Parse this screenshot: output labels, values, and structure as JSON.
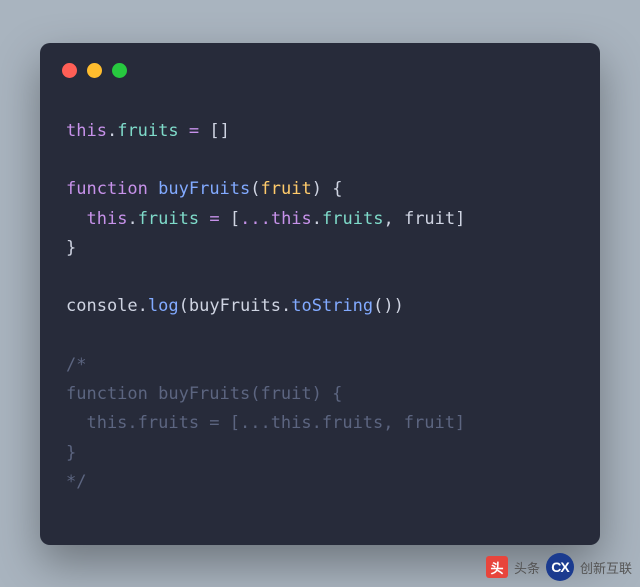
{
  "code": {
    "l1": {
      "this": "this",
      "dot": ".",
      "prop": "fruits",
      "sp": " ",
      "eq": "=",
      "sp2": " ",
      "br": "[]"
    },
    "l2": "",
    "l3": {
      "fn": "function",
      "sp": " ",
      "name": "buyFruits",
      "op": "(",
      "param": "fruit",
      "cp": ")",
      "sp2": " ",
      "ob": "{"
    },
    "l4": {
      "ind": "  ",
      "this": "this",
      "dot": ".",
      "prop": "fruits",
      "sp": " ",
      "eq": "=",
      "sp2": " ",
      "ob": "[",
      "spr": "...",
      "this2": "this",
      "dot2": ".",
      "prop2": "fruits",
      "cm": ",",
      "sp3": " ",
      "arg": "fruit",
      "cb": "]"
    },
    "l5": {
      "cb": "}"
    },
    "l6": "",
    "l7": {
      "obj": "console",
      "dot": ".",
      "m": "log",
      "op": "(",
      "ref": "buyFruits",
      "dot2": ".",
      "m2": "toString",
      "op2": "(",
      "cp2": ")",
      "cp": ")"
    },
    "l8": "",
    "l9": "/*",
    "l10": "function buyFruits(fruit) {",
    "l11": "  this.fruits = [...this.fruits, fruit]",
    "l12": "}",
    "l13": "*/"
  },
  "attribution": {
    "tt_label": "头条",
    "cx_label": "创新互联",
    "tt_icon": "头",
    "cx_icon": "CX"
  },
  "chart_data": {
    "type": "table",
    "title": "JavaScript code snippet",
    "language": "javascript",
    "lines": [
      "this.fruits = []",
      "",
      "function buyFruits(fruit) {",
      "  this.fruits = [...this.fruits, fruit]",
      "}",
      "",
      "console.log(buyFruits.toString())",
      "",
      "/*",
      "function buyFruits(fruit) {",
      "  this.fruits = [...this.fruits, fruit]",
      "}",
      "*/"
    ]
  }
}
